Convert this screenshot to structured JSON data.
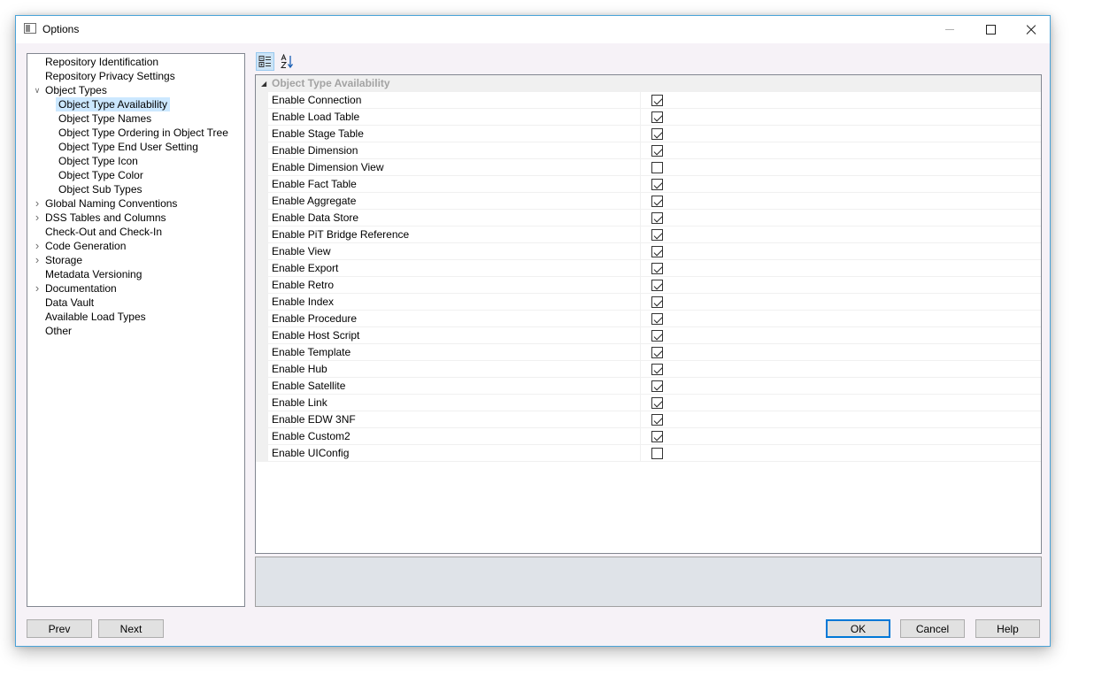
{
  "window": {
    "title": "Options"
  },
  "tree": {
    "items": [
      {
        "label": "Repository Identification",
        "level": 0,
        "expander": "none",
        "selected": false
      },
      {
        "label": "Repository Privacy Settings",
        "level": 0,
        "expander": "none",
        "selected": false
      },
      {
        "label": "Object Types",
        "level": 0,
        "expander": "expanded",
        "selected": false
      },
      {
        "label": "Object Type Availability",
        "level": 1,
        "expander": "none",
        "selected": true
      },
      {
        "label": "Object Type Names",
        "level": 1,
        "expander": "none",
        "selected": false
      },
      {
        "label": "Object Type Ordering in Object Tree",
        "level": 1,
        "expander": "none",
        "selected": false
      },
      {
        "label": "Object Type End User Setting",
        "level": 1,
        "expander": "none",
        "selected": false
      },
      {
        "label": "Object Type Icon",
        "level": 1,
        "expander": "none",
        "selected": false
      },
      {
        "label": "Object Type Color",
        "level": 1,
        "expander": "none",
        "selected": false
      },
      {
        "label": "Object Sub Types",
        "level": 1,
        "expander": "none",
        "selected": false
      },
      {
        "label": "Global Naming Conventions",
        "level": 0,
        "expander": "collapsed",
        "selected": false
      },
      {
        "label": "DSS Tables and Columns",
        "level": 0,
        "expander": "collapsed",
        "selected": false
      },
      {
        "label": "Check-Out and Check-In",
        "level": 0,
        "expander": "none",
        "selected": false
      },
      {
        "label": "Code Generation",
        "level": 0,
        "expander": "collapsed",
        "selected": false
      },
      {
        "label": "Storage",
        "level": 0,
        "expander": "collapsed",
        "selected": false
      },
      {
        "label": "Metadata Versioning",
        "level": 0,
        "expander": "none",
        "selected": false
      },
      {
        "label": "Documentation",
        "level": 0,
        "expander": "collapsed",
        "selected": false
      },
      {
        "label": "Data Vault",
        "level": 0,
        "expander": "none",
        "selected": false
      },
      {
        "label": "Available Load Types",
        "level": 0,
        "expander": "none",
        "selected": false
      },
      {
        "label": "Other",
        "level": 0,
        "expander": "none",
        "selected": false
      }
    ]
  },
  "toolbar": {
    "categorized_icon": "categorized-sort-icon",
    "alphabetical_icon": "alphabetical-sort-icon"
  },
  "grid": {
    "category": "Object Type Availability",
    "properties": [
      {
        "name": "Enable Connection",
        "checked": true
      },
      {
        "name": "Enable Load Table",
        "checked": true
      },
      {
        "name": "Enable Stage Table",
        "checked": true
      },
      {
        "name": "Enable Dimension",
        "checked": true
      },
      {
        "name": "Enable Dimension View",
        "checked": false
      },
      {
        "name": "Enable Fact Table",
        "checked": true
      },
      {
        "name": "Enable Aggregate",
        "checked": true
      },
      {
        "name": "Enable Data Store",
        "checked": true
      },
      {
        "name": "Enable PiT Bridge Reference",
        "checked": true
      },
      {
        "name": "Enable View",
        "checked": true
      },
      {
        "name": "Enable Export",
        "checked": true
      },
      {
        "name": "Enable Retro",
        "checked": true
      },
      {
        "name": "Enable Index",
        "checked": true
      },
      {
        "name": "Enable Procedure",
        "checked": true
      },
      {
        "name": "Enable Host Script",
        "checked": true
      },
      {
        "name": "Enable Template",
        "checked": true
      },
      {
        "name": "Enable Hub",
        "checked": true
      },
      {
        "name": "Enable Satellite",
        "checked": true
      },
      {
        "name": "Enable Link",
        "checked": true
      },
      {
        "name": "Enable EDW 3NF",
        "checked": true
      },
      {
        "name": "Enable Custom2",
        "checked": true
      },
      {
        "name": "Enable UIConfig",
        "checked": false
      }
    ]
  },
  "buttons": {
    "prev": "Prev",
    "next": "Next",
    "ok": "OK",
    "cancel": "Cancel",
    "help": "Help"
  },
  "colors": {
    "selection": "#cce8ff",
    "window_border": "#4aa3d8",
    "category_text": "#a3a3a3",
    "description_bg": "#dfe3e8"
  }
}
